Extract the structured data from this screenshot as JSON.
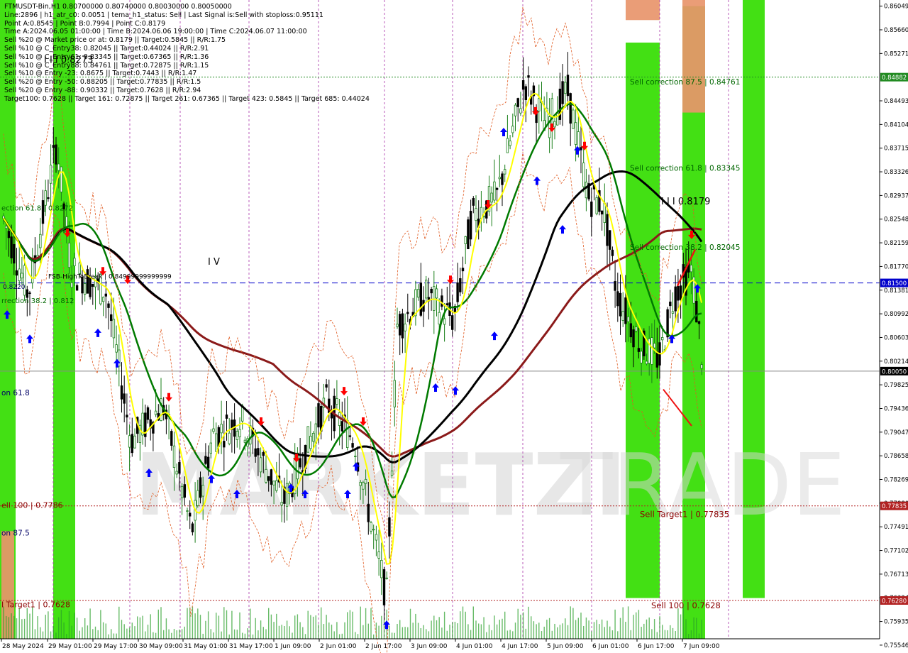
{
  "header": {
    "lines": [
      "FTMUSDT-Bin,H1  0.80700000 0.80740000 0.80030000 0.80050000",
      "Line:2896 | h1_atr_c0: 0.0051 | tema_h1_status: Sell | Last Signal is:Sell with stoploss:0.95111",
      "Point A:0.8545 | Point B:0.7994 | Point C:0.8179",
      "Time A:2024.06.05 01:00:00 | Time B:2024.06.06 19:00:00 | Time C:2024.06.07 11:00:00",
      "Sell %20 @ Market price or at: 0.8179 || Target:0.5845 || R/R:1.75",
      "Sell %10 @ C_Entry38: 0.82045 || Target:0.44024 || R/R:2.91",
      "Sell %10 @ C_Entry61: 0.83345 || Target:0.67365 || R/R:1.36",
      "Sell %10 @ C_Entry88: 0.84761 || Target:0.72875 || R/R:1.15",
      "Sell %10 @ Entry -23: 0.8675 || Target:0.7443 || R/R:1.47",
      "Sell %20 @ Entry -50: 0.88205 || Target:0.77835 || R/R:1.5",
      "Sell %20 @ Entry -88: 0.90332 || Target:0.7628 || R/R:2.94",
      "Target100: 0.7628 || Target 161: 0.72875 || Target 261: 0.67365 || Target 423: 0.5845 || Target 685: 0.44024"
    ]
  },
  "watermark": {
    "text_left": "MARKETZI",
    "text_right": "TRADE"
  },
  "colors": {
    "bull": "#1a7f1a",
    "bear": "#000000",
    "yellow": "#ffff00",
    "green_ma": "#007a00",
    "black_ma": "#000000",
    "maroon_ma": "#8b1a1a",
    "zone_green": "#33dd00",
    "zone_orange": "#e8956b",
    "dashed_blue": "#0000cc",
    "level_red": "#b22222",
    "level_green": "#228b22",
    "up_arrow": "#0000ff",
    "down_arrow": "#ff0000"
  },
  "chart_data": {
    "type": "candlestick",
    "symbol": "FTMUSDT-Bin",
    "timeframe": "H1",
    "ylim": [
      0.7565,
      0.8615
    ],
    "y_ticks": [
      "0.86049",
      "0.85660",
      "0.85271",
      "0.84882",
      "0.84493",
      "0.84104",
      "0.83715",
      "0.83326",
      "0.82937",
      "0.82548",
      "0.82159",
      "0.81770",
      "0.81500",
      "0.81381",
      "0.80992",
      "0.80603",
      "0.80214",
      "0.80050",
      "0.79825",
      "0.79436",
      "0.79047",
      "0.78658",
      "0.78269",
      "0.77880",
      "0.77835",
      "0.77491",
      "0.77102",
      "0.76713",
      "0.76324",
      "0.76280",
      "0.75935",
      "0.75546"
    ],
    "x_labels": [
      "28 May 2024",
      "29 May 01:00",
      "29 May 17:00",
      "30 May 09:00",
      "31 May 01:00",
      "31 May 17:00",
      "1 Jun 09:00",
      "2 Jun 01:00",
      "2 Jun 17:00",
      "3 Jun 09:00",
      "4 Jun 01:00",
      "4 Jun 17:00",
      "5 Jun 09:00",
      "6 Jun 01:00",
      "6 Jun 17:00",
      "7 Jun 09:00"
    ],
    "current_price": 0.8005,
    "horizontal_lines": [
      {
        "price": 0.815,
        "style": "dashed",
        "color": "#0000cc",
        "badge": "0.81500"
      },
      {
        "price": 0.84882,
        "style": "dotted",
        "color": "#228b22",
        "badge": "0.84882"
      },
      {
        "price": 0.77835,
        "style": "dotted",
        "color": "#b22222",
        "badge": "0.77835"
      },
      {
        "price": 0.7628,
        "style": "dotted",
        "color": "#b22222",
        "badge": "0.76280"
      },
      {
        "price": 0.8005,
        "style": "solid",
        "color": "#888888",
        "badge": "0.80050"
      }
    ],
    "annotations": [
      {
        "text": "Sell correction 87.5 | 0.84761",
        "price": 0.84761
      },
      {
        "text": "Sell correction 61.8 | 0.83345",
        "price": 0.83345
      },
      {
        "text": "I I I 0.8179",
        "price": 0.8279
      },
      {
        "text": "Sell correction 38.2 | 0.82045",
        "price": 0.82045
      },
      {
        "text": "Sell Target1 | 0.77835",
        "price": 0.7765
      },
      {
        "text": "Sell 100 | 0.7628",
        "price": 0.7615
      },
      {
        "text": "I V",
        "price": 0.818
      },
      {
        "text": "FSB-HighToBreak | 0.84999999999999",
        "price": 0.8157
      },
      {
        "text": "ell 100 | 0.7786",
        "price": 0.778
      },
      {
        "text": "I Target1 | 0.7628",
        "price": 0.7617
      },
      {
        "text": "on 61.8",
        "price": 0.7965
      },
      {
        "text": "on 87.5",
        "price": 0.7735
      },
      {
        "text": "ection 61.8 | 0.8272",
        "price": 0.8269
      },
      {
        "text": "rrection 38.2 | 0.812",
        "price": 0.8117
      },
      {
        "text": "I I I 0.8273",
        "price": 0.8512
      },
      {
        "text": "0.8220",
        "price": 0.814
      }
    ]
  }
}
